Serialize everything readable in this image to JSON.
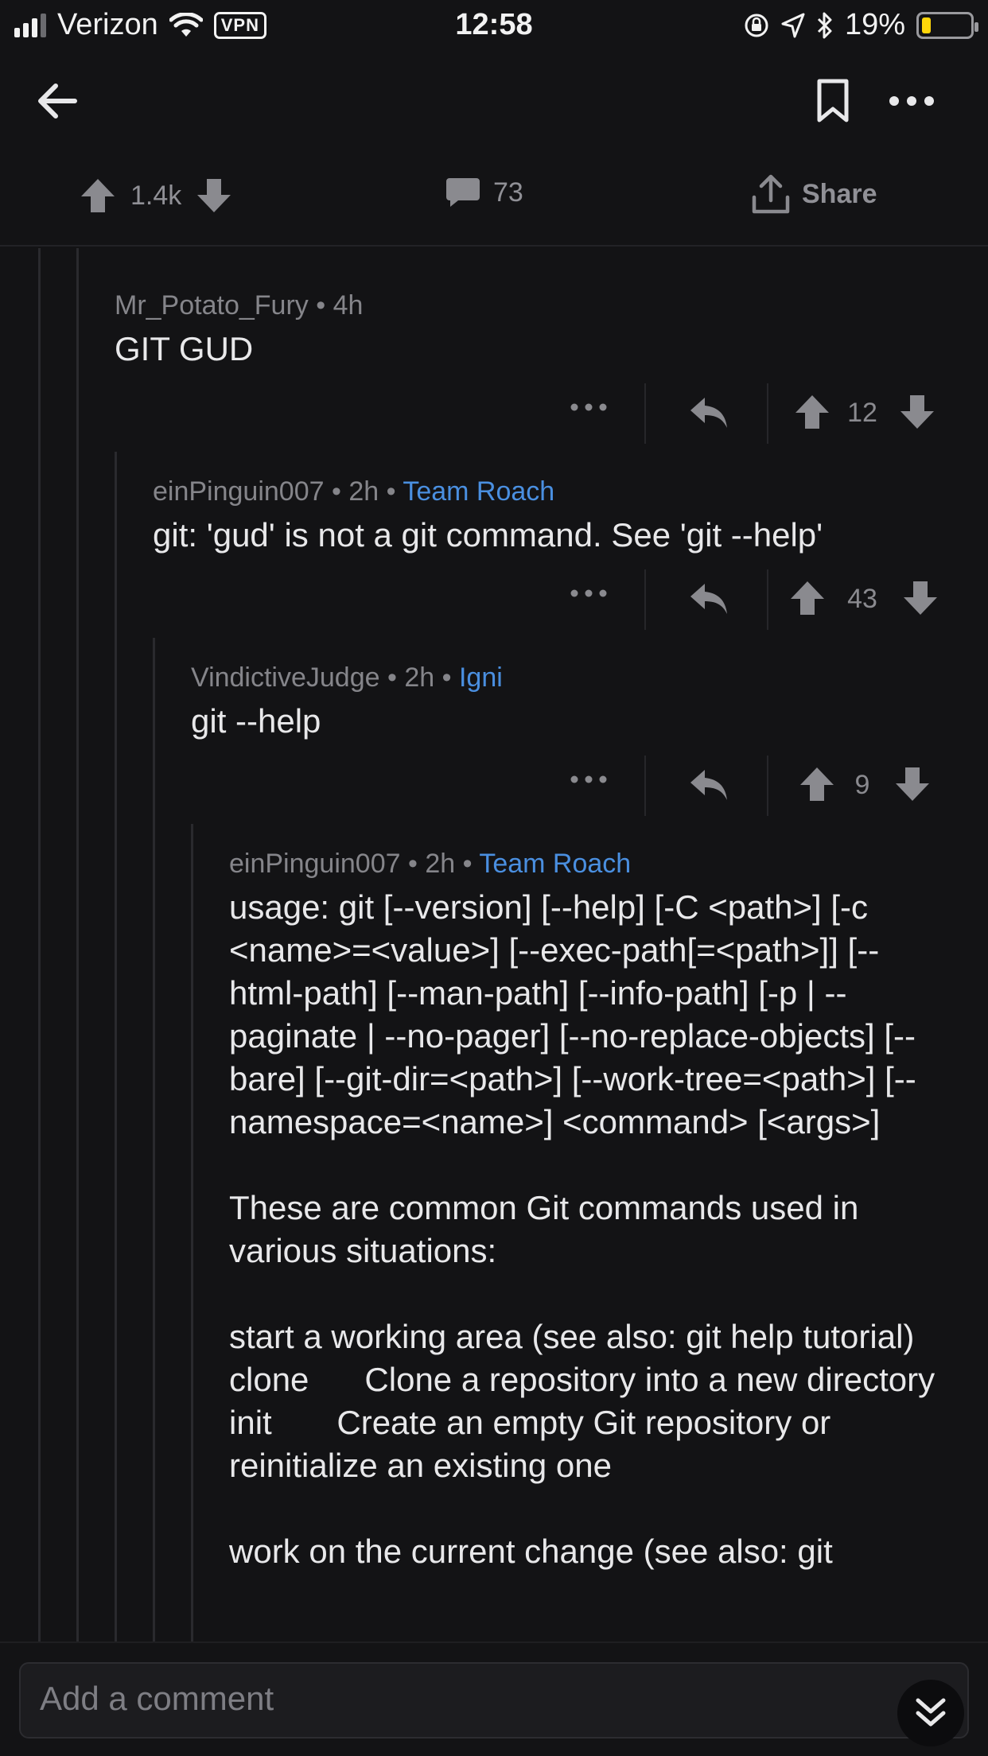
{
  "status_bar": {
    "carrier": "Verizon",
    "vpn": "VPN",
    "time": "12:58",
    "battery": "19%",
    "battery_level": 0.19
  },
  "nav": {
    "back_icon": "arrow-left-icon",
    "bookmark_icon": "bookmark-icon",
    "more_icon": "more-horizontal-icon"
  },
  "post_actions": {
    "score": "1.4k",
    "comments": "73",
    "share": "Share"
  },
  "comments": [
    {
      "author": "Mr_Potato_Fury",
      "age": "4h",
      "flair": "",
      "body": [
        "GIT GUD"
      ],
      "score": "12"
    },
    {
      "author": "einPinguin007",
      "age": "2h",
      "flair": "Team Roach",
      "body": [
        "git: 'gud' is not a git command. See 'git --help'"
      ],
      "score": "43"
    },
    {
      "author": "VindictiveJudge",
      "age": "2h",
      "flair": "Igni",
      "body": [
        "git --help"
      ],
      "score": "9"
    },
    {
      "author": "einPinguin007",
      "age": "2h",
      "flair": "Team Roach",
      "body": [
        "usage: git [--version] [--help] [-C <path>] [-c <name>=<value>] [--exec-path[=<path>]] [--html-path] [--man-path] [--info-path] [-p | --paginate | --no-pager] [--no-replace-objects] [--bare] [--git-dir=<path>] [--work-tree=<path>] [--namespace=<name>] <command> [<args>]",
        "These are common Git commands used in various situations:",
        "start a working area (see also: git help tutorial) clone      Clone a repository into a new directory init       Create an empty Git repository or reinitialize an existing one",
        "work on the current change (see also: git"
      ],
      "score": ""
    }
  ],
  "footer": {
    "placeholder": "Add a comment",
    "jump_icon": "chevrons-down-icon"
  }
}
